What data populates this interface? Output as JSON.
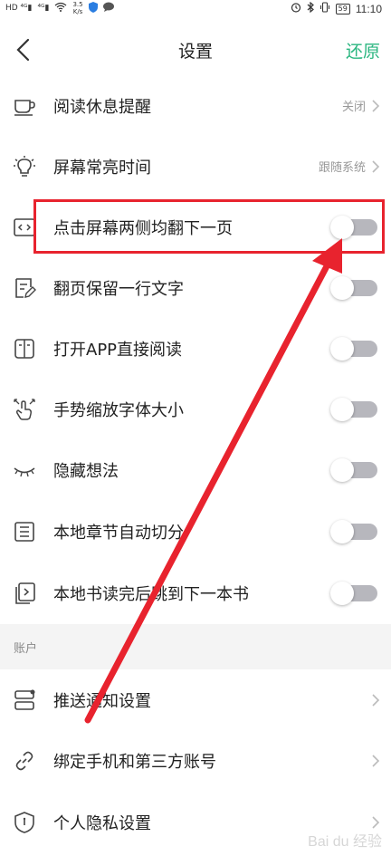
{
  "status_bar": {
    "net_speed_value": "3.5",
    "net_speed_unit": "K/s",
    "battery": "59",
    "time": "11:10"
  },
  "header": {
    "title": "设置",
    "restore_label": "还原"
  },
  "settings": [
    {
      "label": "阅读休息提醒",
      "value": "关闭"
    },
    {
      "label": "屏幕常亮时间",
      "value": "跟随系统"
    },
    {
      "label": "点击屏幕两侧均翻下一页",
      "toggle": "off"
    },
    {
      "label": "翻页保留一行文字",
      "toggle": "off"
    },
    {
      "label": "打开APP直接阅读",
      "toggle": "off"
    },
    {
      "label": "手势缩放字体大小",
      "toggle": "off"
    },
    {
      "label": "隐藏想法",
      "toggle": "off"
    },
    {
      "label": "本地章节自动切分",
      "toggle": "off"
    },
    {
      "label": "本地书读完后跳到下一本书",
      "toggle": "off"
    }
  ],
  "account_section": {
    "title": "账户",
    "items": [
      {
        "label": "推送通知设置"
      },
      {
        "label": "绑定手机和第三方账号"
      },
      {
        "label": "个人隐私设置"
      }
    ]
  },
  "colors": {
    "accent": "#2bb680",
    "annotation": "#e8232e",
    "toggle_track": "#b7b7bd"
  }
}
